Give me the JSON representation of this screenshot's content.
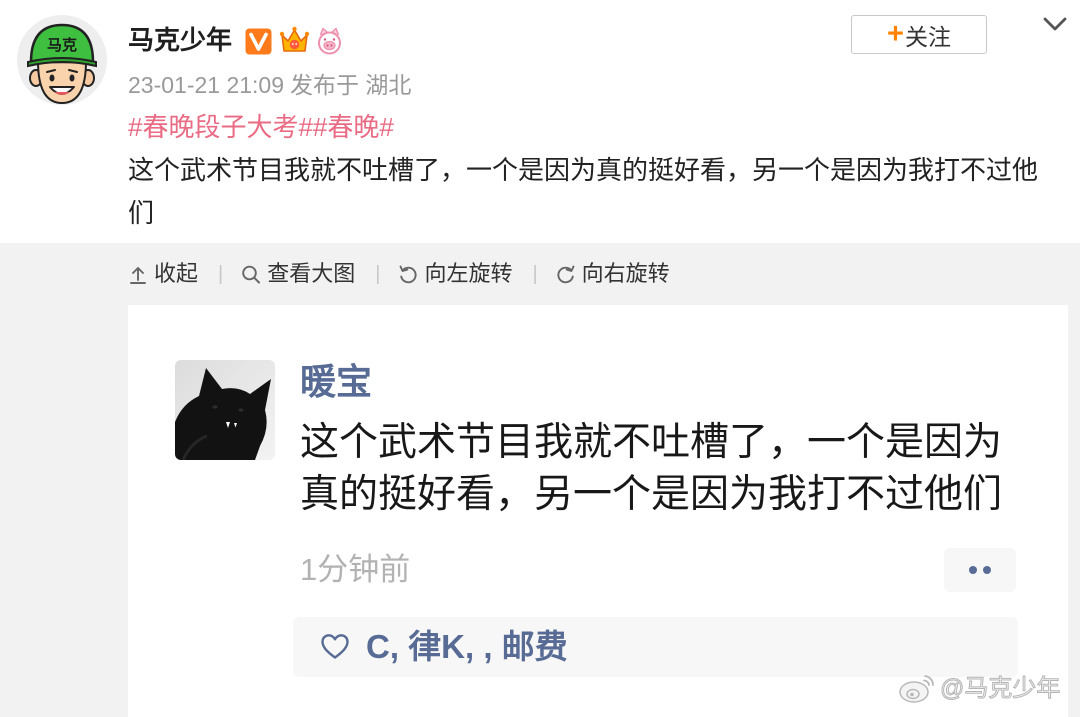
{
  "header": {
    "author_name": "马克少年",
    "avatar": {
      "icon": "cartoon-avatar-icon",
      "cap_text": "马克"
    },
    "badges": [
      {
        "icon": "verified-v-icon"
      },
      {
        "icon": "crown-icon"
      },
      {
        "icon": "pig-icon"
      }
    ],
    "follow_button": {
      "plus": "+",
      "label": "关注"
    },
    "more_icon": "chevron-down-icon",
    "meta": {
      "time": "23-01-21 21:09",
      "location": "发布于 湖北"
    }
  },
  "post": {
    "hashtags": [
      "#春晚段子大考#",
      "#春晚#"
    ],
    "text": "这个武术节目我就不吐槽了，一个是因为真的挺好看，另一个是因为我打不过他们"
  },
  "toolbar": {
    "items": [
      {
        "icon": "collapse-icon",
        "label": "收起"
      },
      {
        "icon": "search-icon",
        "label": "查看大图"
      },
      {
        "icon": "rotate-left-icon",
        "label": "向左旋转"
      },
      {
        "icon": "rotate-right-icon",
        "label": "向右旋转"
      }
    ],
    "separator": "|"
  },
  "image": {
    "moment": {
      "avatar_icon": "black-cat-avatar-icon",
      "name": "暖宝",
      "text": "这个武术节目我就不吐槽了，一个是因为真的挺好看，另一个是因为我打不过他们",
      "time": "1分钟前",
      "more_icon": "more-dots-icon",
      "likes_icon": "heart-outline-icon",
      "likes": "C, 律K, , 邮费"
    },
    "watermark": {
      "icon": "weibo-logo-icon",
      "text": "@马克少年"
    }
  },
  "colors": {
    "hashtag": "#e96b84",
    "link_blue": "#576b95",
    "meta_gray": "#999999",
    "follow_plus": "#ff8200",
    "panel_bg": "#f2f2f2",
    "badge_v": "#ff7a1a"
  }
}
